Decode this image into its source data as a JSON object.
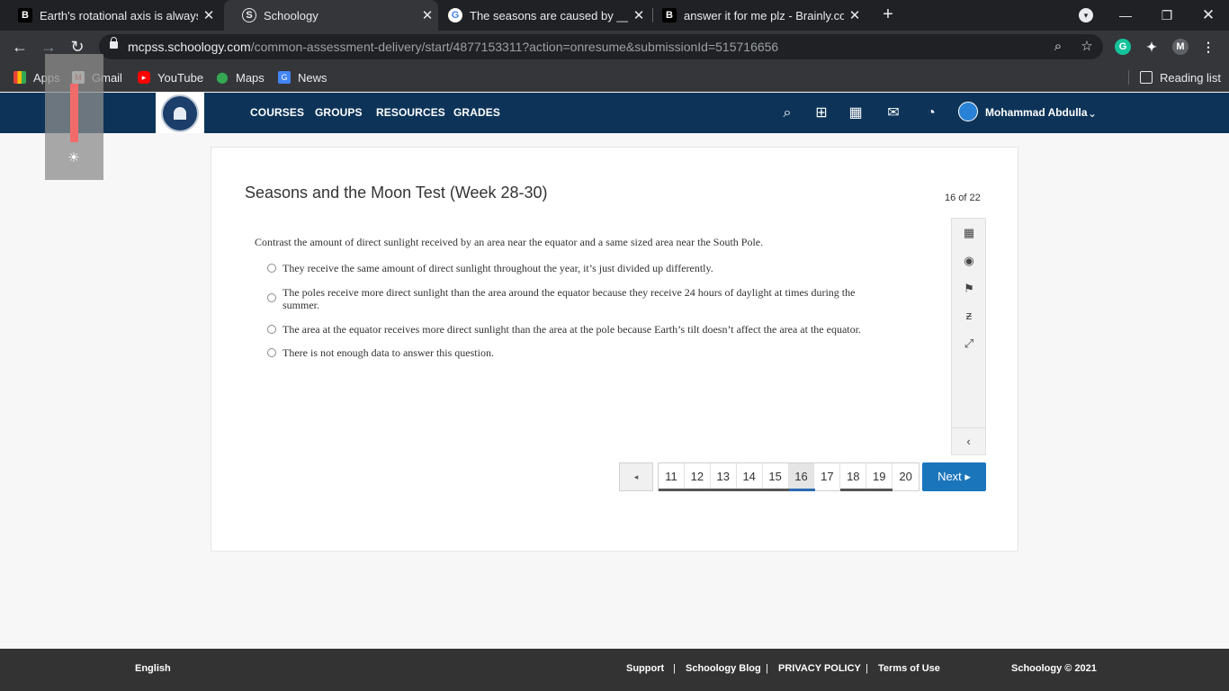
{
  "browser": {
    "tabs": [
      {
        "title": "Earth's rotational axis is always til",
        "favicon": "B",
        "active": false
      },
      {
        "title": "Schoology",
        "favicon": "S",
        "active": true
      },
      {
        "title": "The seasons are caused by ______",
        "favicon": "G",
        "active": false
      },
      {
        "title": "answer it for me plz - Brainly.com",
        "favicon": "B",
        "active": false
      }
    ],
    "url_host": "mcpss.schoology.com",
    "url_path": "/common-assessment-delivery/start/4877153311?action=onresume&submissionId=515716656",
    "profile_initial": "M",
    "bookmarks": [
      {
        "label": "Apps",
        "icon": "apps-icon"
      },
      {
        "label": "Gmail",
        "icon": "gmail-icon"
      },
      {
        "label": "YouTube",
        "icon": "youtube-icon"
      },
      {
        "label": "Maps",
        "icon": "maps-icon"
      },
      {
        "label": "News",
        "icon": "news-icon"
      }
    ],
    "reading_list": "Reading list"
  },
  "header": {
    "nav": [
      "COURSES",
      "GROUPS",
      "RESOURCES",
      "GRADES"
    ],
    "user_name": "Mohammad Abdulla"
  },
  "assessment": {
    "title": "Seasons and the Moon Test (Week 28-30)",
    "progress": "16 of 22",
    "question": "Contrast the amount of direct sunlight received by an area near the equator and a same sized area near the South Pole.",
    "choices": [
      "They receive the same amount of direct sunlight throughout the year, it’s just divided up differently.",
      "The poles receive more direct sunlight than the area around the equator because they receive 24 hours of daylight at times during the summer.",
      "The area at the equator receives more direct sunlight than the area at the pole because Earth’s tilt doesn’t affect the area at the equator.",
      "There is not enough data to answer this question."
    ],
    "pagination": {
      "prev": "◂",
      "pages": [
        "11",
        "12",
        "13",
        "14",
        "15",
        "16",
        "17",
        "18",
        "19",
        "20"
      ],
      "current": "16",
      "next": "Next ▸"
    }
  },
  "footer": {
    "language": "English",
    "links": [
      "Support",
      "Schoology Blog",
      "PRIVACY POLICY",
      "Terms of Use"
    ],
    "separator": "|",
    "copyright": "Schoology © 2021"
  },
  "colors": {
    "header_bg": "#0d3458",
    "next_button": "#1b75bb",
    "footer_bg": "#333333",
    "current_page_indicator": "#2b6cb0"
  }
}
